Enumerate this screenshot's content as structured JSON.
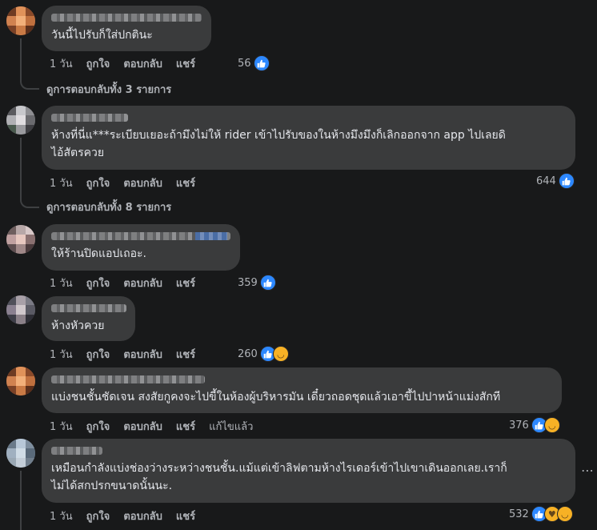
{
  "comments": [
    {
      "text": "วันนี้ไปรับก็ใส่ปกตินะ",
      "actions": {
        "time": "1 วัน",
        "like": "ถูกใจ",
        "reply": "ตอบกลับ",
        "share": "แชร์"
      },
      "reaction_count": "56",
      "reactions": [
        "like"
      ],
      "replies_label": "ดูการตอบกลับทั้ง 3 รายการ"
    },
    {
      "text": "ห้างที่นี่แ***ระเบียบเยอะถ้ามึงไม่ให้ rider เข้าไปรับของในห้างมึงมึงก็เลิกออกจาก app ไปเลยดิ\nไอ้สัตรควย",
      "actions": {
        "time": "1 วัน",
        "like": "ถูกใจ",
        "reply": "ตอบกลับ",
        "share": "แชร์"
      },
      "reaction_count": "644",
      "reactions": [
        "like"
      ],
      "replies_label": "ดูการตอบกลับทั้ง 8 รายการ"
    },
    {
      "text": "ให้ร้านปิดแอปเถอะ.",
      "actions": {
        "time": "1 วัน",
        "like": "ถูกใจ",
        "reply": "ตอบกลับ",
        "share": "แชร์"
      },
      "reaction_count": "359",
      "reactions": [
        "like"
      ]
    },
    {
      "text": "ห้างหัวควย",
      "actions": {
        "time": "1 วัน",
        "like": "ถูกใจ",
        "reply": "ตอบกลับ",
        "share": "แชร์"
      },
      "reaction_count": "260",
      "reactions": [
        "like",
        "haha"
      ]
    },
    {
      "text": "แบ่งชนชั้นชัดเจน สงสัยกูคงจะไปขี้ในห้องผู้บริหารมัน เดี๋ยวถอดชุดแล้วเอาขี้ไปปาหน้าแม่งสักที",
      "actions": {
        "time": "1 วัน",
        "like": "ถูกใจ",
        "reply": "ตอบกลับ",
        "share": "แชร์",
        "edited": "แก้ไขแล้ว"
      },
      "reaction_count": "376",
      "reactions": [
        "like",
        "haha"
      ]
    },
    {
      "text": "เหมือนกำลังแบ่งช่องว่างระหว่างชนชั้น.แม้แต่เข้าลิฟตามห้างไรเดอร์เข้าไปเขาเดินออกเลย.เราก็\nไม่ได้สกปรกขนาดนั้นนะ.",
      "actions": {
        "time": "1 วัน",
        "like": "ถูกใจ",
        "reply": "ตอบกลับ",
        "share": "แชร์"
      },
      "reaction_count": "532",
      "reactions": [
        "like",
        "care",
        "haha"
      ]
    }
  ],
  "icons": {
    "like": "thumbs-up-icon",
    "haha": "haha-emoji-icon",
    "care": "care-emoji-icon",
    "more": "more-options-icon"
  },
  "colors": {
    "background": "#18191a",
    "bubble": "#3a3b3c",
    "like_blue": "#2d88ff",
    "emoji_yellow": "#f7b125",
    "secondary_text": "#b0b3b8"
  }
}
